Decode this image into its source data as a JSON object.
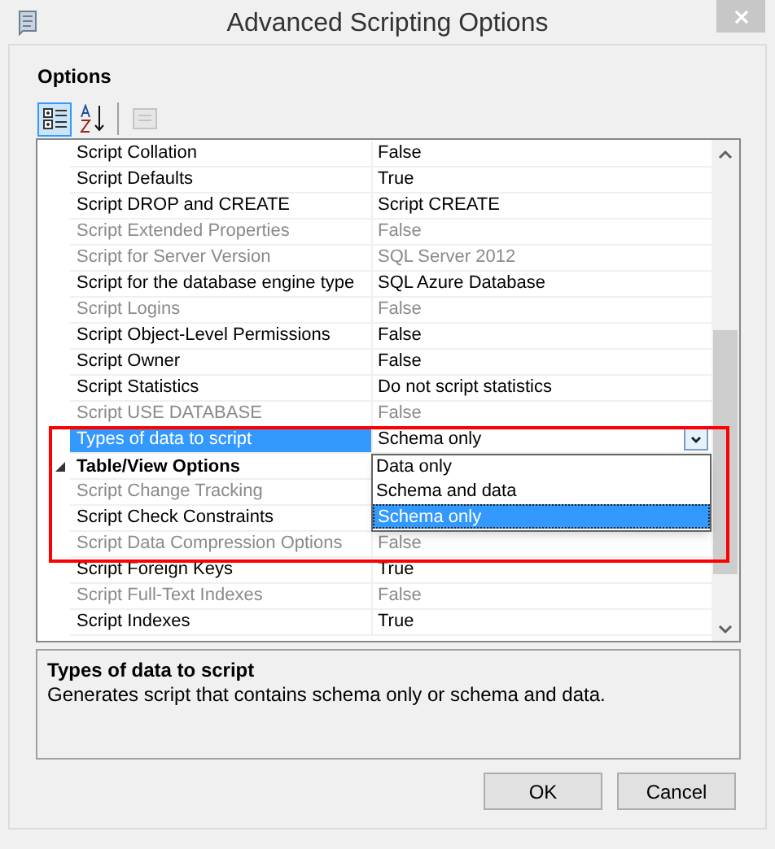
{
  "window": {
    "title": "Advanced Scripting Options"
  },
  "options_label": "Options",
  "toolbar": [
    {
      "kind": "categorized",
      "selected": true,
      "disabled": false
    },
    {
      "kind": "alphabetical",
      "selected": false,
      "disabled": false
    },
    {
      "kind": "pages",
      "selected": false,
      "disabled": true
    }
  ],
  "properties": [
    {
      "kind": "property",
      "name": "Script Collation",
      "value": "False",
      "disabled": false,
      "selected": false
    },
    {
      "kind": "property",
      "name": "Script Defaults",
      "value": "True",
      "disabled": false,
      "selected": false
    },
    {
      "kind": "property",
      "name": "Script DROP and CREATE",
      "value": "Script CREATE",
      "disabled": false,
      "selected": false
    },
    {
      "kind": "property",
      "name": "Script Extended Properties",
      "value": "False",
      "disabled": true,
      "selected": false
    },
    {
      "kind": "property",
      "name": "Script for Server Version",
      "value": "SQL Server 2012",
      "disabled": true,
      "selected": false
    },
    {
      "kind": "property",
      "name": "Script for the database engine type",
      "value": "SQL Azure Database",
      "disabled": false,
      "selected": false
    },
    {
      "kind": "property",
      "name": "Script Logins",
      "value": "False",
      "disabled": true,
      "selected": false
    },
    {
      "kind": "property",
      "name": "Script Object-Level Permissions",
      "value": "False",
      "disabled": false,
      "selected": false
    },
    {
      "kind": "property",
      "name": "Script Owner",
      "value": "False",
      "disabled": false,
      "selected": false
    },
    {
      "kind": "property",
      "name": "Script Statistics",
      "value": "Do not script statistics",
      "disabled": false,
      "selected": false
    },
    {
      "kind": "property",
      "name": "Script USE DATABASE",
      "value": "False",
      "disabled": true,
      "selected": false
    },
    {
      "kind": "property",
      "name": "Types of data to script",
      "value": "Schema only",
      "disabled": false,
      "selected": true
    },
    {
      "kind": "category",
      "name": "Table/View Options",
      "expanded": true
    },
    {
      "kind": "property",
      "name": "Script Change Tracking",
      "disabled": true,
      "selected": false
    },
    {
      "kind": "property",
      "name": "Script Check Constraints",
      "disabled": false,
      "selected": false
    },
    {
      "kind": "property",
      "name": "Script Data Compression Options",
      "value": "False",
      "disabled": true,
      "selected": false
    },
    {
      "kind": "property",
      "name": "Script Foreign Keys",
      "value": "True",
      "disabled": false,
      "selected": false
    },
    {
      "kind": "property",
      "name": "Script Full-Text Indexes",
      "value": "False",
      "disabled": true,
      "selected": false
    },
    {
      "kind": "property",
      "name": "Script Indexes",
      "value": "True",
      "disabled": false,
      "selected": false
    }
  ],
  "dropdown_list": [
    {
      "label": "Data only",
      "selected": false
    },
    {
      "label": "Schema and data",
      "selected": false
    },
    {
      "label": "Schema only",
      "selected": true
    }
  ],
  "description": {
    "title": "Types of data to script",
    "text": "Generates script that contains schema only or schema and data."
  },
  "buttons": [
    "OK",
    "Cancel"
  ]
}
